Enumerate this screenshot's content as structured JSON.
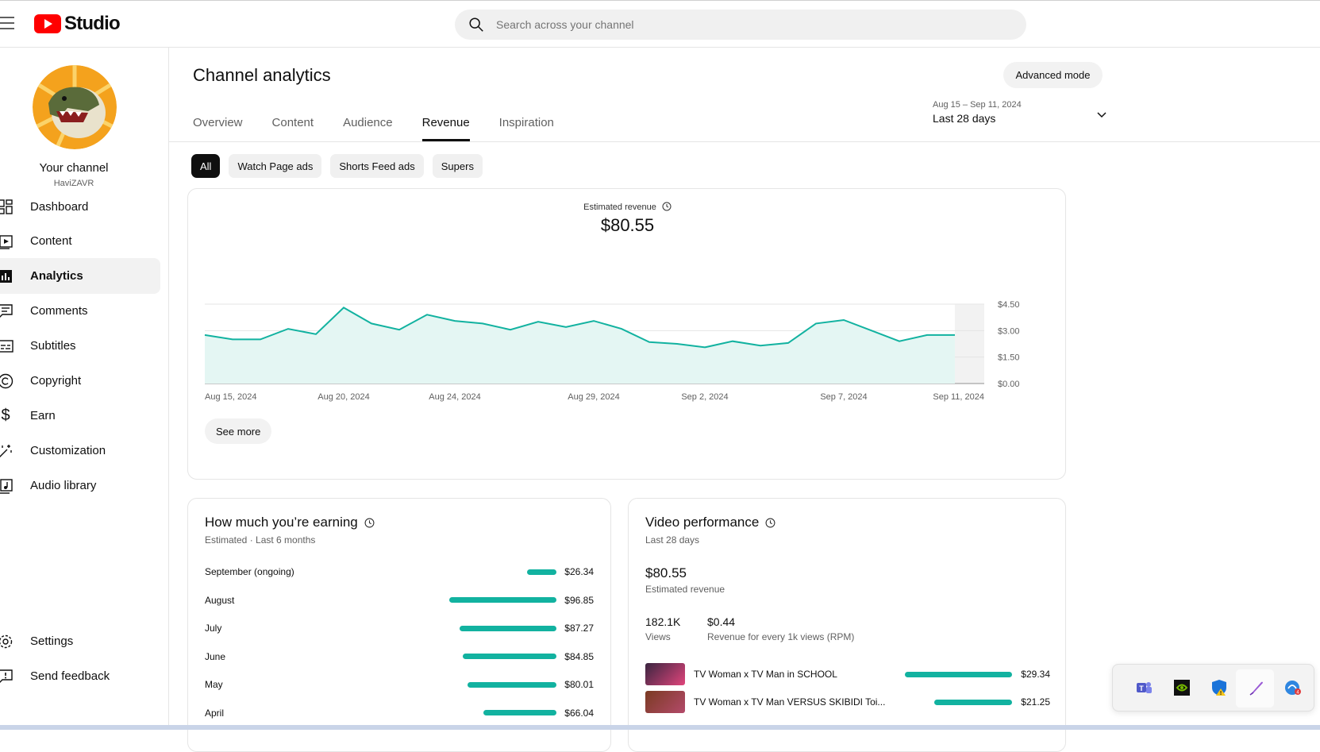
{
  "app": {
    "brand": "Studio",
    "search_placeholder": "Search across your channel"
  },
  "sidebar": {
    "channel_name": "Your channel",
    "channel_handle": "HaviZAVR",
    "items": [
      {
        "label": "Dashboard",
        "icon": "dashboard-icon"
      },
      {
        "label": "Content",
        "icon": "content-icon"
      },
      {
        "label": "Analytics",
        "icon": "analytics-icon",
        "active": true
      },
      {
        "label": "Comments",
        "icon": "comments-icon"
      },
      {
        "label": "Subtitles",
        "icon": "subtitles-icon"
      },
      {
        "label": "Copyright",
        "icon": "copyright-icon"
      },
      {
        "label": "Earn",
        "icon": "earn-icon"
      },
      {
        "label": "Customization",
        "icon": "customization-icon"
      },
      {
        "label": "Audio library",
        "icon": "audio-library-icon"
      }
    ],
    "bottom_items": [
      {
        "label": "Settings",
        "icon": "gear-icon"
      },
      {
        "label": "Send feedback",
        "icon": "feedback-icon"
      }
    ]
  },
  "page": {
    "title": "Channel analytics",
    "advanced_mode": "Advanced mode",
    "tabs": [
      "Overview",
      "Content",
      "Audience",
      "Revenue",
      "Inspiration"
    ],
    "active_tab": "Revenue",
    "date_range": "Aug 15 – Sep 11, 2024",
    "date_label": "Last 28 days",
    "chips": [
      "All",
      "Watch Page ads",
      "Shorts Feed ads",
      "Supers"
    ],
    "active_chip": "All"
  },
  "main_card": {
    "metric_label": "Estimated revenue",
    "metric_value": "$80.55",
    "see_more": "See more"
  },
  "chart_data": {
    "type": "area",
    "title": "Estimated revenue",
    "x": [
      "Aug 15, 2024",
      "Aug 16, 2024",
      "Aug 17, 2024",
      "Aug 18, 2024",
      "Aug 19, 2024",
      "Aug 20, 2024",
      "Aug 21, 2024",
      "Aug 22, 2024",
      "Aug 23, 2024",
      "Aug 24, 2024",
      "Aug 25, 2024",
      "Aug 26, 2024",
      "Aug 27, 2024",
      "Aug 28, 2024",
      "Aug 29, 2024",
      "Aug 30, 2024",
      "Aug 31, 2024",
      "Sep 1, 2024",
      "Sep 2, 2024",
      "Sep 3, 2024",
      "Sep 4, 2024",
      "Sep 5, 2024",
      "Sep 6, 2024",
      "Sep 7, 2024",
      "Sep 8, 2024",
      "Sep 9, 2024",
      "Sep 10, 2024",
      "Sep 11, 2024"
    ],
    "x_tick_labels": [
      "Aug 15, 2024",
      "Aug 20, 2024",
      "Aug 24, 2024",
      "Aug 29, 2024",
      "Sep 2, 2024",
      "Sep 7, 2024",
      "Sep 11, 2024"
    ],
    "series": [
      {
        "values": [
          2.75,
          2.5,
          2.5,
          3.1,
          2.8,
          4.3,
          3.4,
          3.05,
          3.9,
          3.55,
          3.4,
          3.05,
          3.5,
          3.2,
          3.55,
          3.1,
          2.35,
          2.25,
          2.05,
          2.4,
          2.15,
          2.3,
          3.4,
          3.6,
          3.0,
          2.4,
          2.75,
          2.75
        ]
      }
    ],
    "y_ticks": [
      "$0.00",
      "$1.50",
      "$3.00",
      "$4.50"
    ],
    "ylim": [
      0,
      4.5
    ],
    "line_color": "#12b2a0",
    "fill_color": "#e4f6f3"
  },
  "earning_card": {
    "title": "How much you’re earning",
    "subtitle": "Estimated · Last 6 months",
    "rows": [
      {
        "month": "September (ongoing)",
        "amount": "$26.34",
        "value": 26.34
      },
      {
        "month": "August",
        "amount": "$96.85",
        "value": 96.85
      },
      {
        "month": "July",
        "amount": "$87.27",
        "value": 87.27
      },
      {
        "month": "June",
        "amount": "$84.85",
        "value": 84.85
      },
      {
        "month": "May",
        "amount": "$80.01",
        "value": 80.01
      },
      {
        "month": "April",
        "amount": "$66.04",
        "value": 66.04
      }
    ]
  },
  "video_card": {
    "title": "Video performance",
    "subtitle": "Last 28 days",
    "revenue": "$80.55",
    "revenue_label": "Estimated revenue",
    "views": "182.1K",
    "views_label": "Views",
    "rpm": "$0.44",
    "rpm_label": "Revenue for every 1k views (RPM)",
    "videos": [
      {
        "title": "TV Woman x TV Man in SCHOOL",
        "amount": "$29.34",
        "value": 29.34
      },
      {
        "title": "TV Woman x TV Man VERSUS SKIBIDI Toi...",
        "amount": "$21.25",
        "value": 21.25
      }
    ]
  },
  "colors": {
    "accent": "#12b2a0",
    "brand_red": "#ff0000"
  },
  "tray": {
    "icons": [
      "teams-icon",
      "nvidia-icon",
      "defender-icon",
      "pen-icon",
      "notification-app-icon"
    ]
  }
}
